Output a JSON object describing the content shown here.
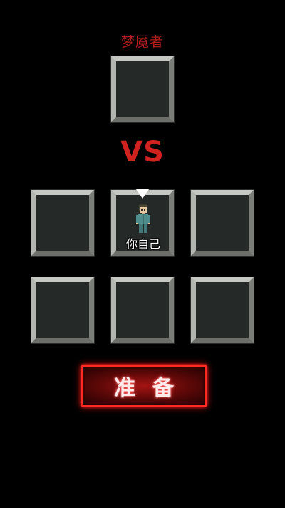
{
  "opponent": {
    "label": "梦魇者"
  },
  "vs_text": "VS",
  "players": {
    "self_label": "你自己"
  },
  "slots": [
    {
      "role": "opponent",
      "occupied": false
    },
    {
      "role": "team",
      "occupied": false
    },
    {
      "role": "team",
      "occupied": true,
      "occupant": "self"
    },
    {
      "role": "team",
      "occupied": false
    },
    {
      "role": "team",
      "occupied": false
    },
    {
      "role": "team",
      "occupied": false
    },
    {
      "role": "team",
      "occupied": false
    }
  ],
  "ready_button": {
    "label": "准备"
  },
  "colors": {
    "background": "#000000",
    "accent_red": "#d0231f",
    "opponent_label": "#b21c1c",
    "slot_frame": "#9a9d97",
    "slot_fill": "#252927"
  },
  "icons": {
    "marker": "triangle-down-icon",
    "avatar": "player-avatar"
  }
}
